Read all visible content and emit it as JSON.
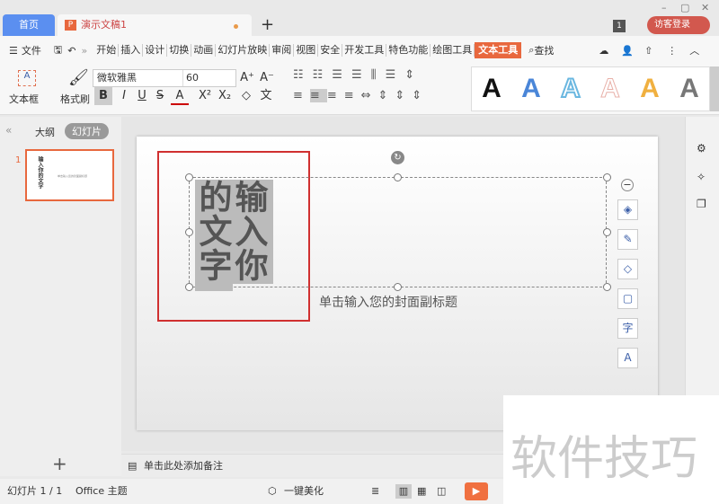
{
  "tabs": {
    "home": "首页",
    "doc": "演示文稿1",
    "new": "+"
  },
  "titlebar": {
    "badge": "1",
    "login": "访客登录",
    "minimize": "–",
    "maximize": "▢",
    "close": "✕"
  },
  "menu": {
    "file": "文件",
    "items": [
      "开始",
      "插入",
      "设计",
      "切换",
      "动画",
      "幻灯片放映",
      "审阅",
      "视图",
      "安全",
      "开发工具",
      "特色功能",
      "绘图工具",
      "文本工具"
    ],
    "active": "文本工具",
    "search": "查找"
  },
  "ribbon": {
    "textbox": "文本框",
    "format_painter": "格式刷",
    "font": "微软雅黑",
    "size": "60",
    "styles": [
      {
        "color": "#111111"
      },
      {
        "color": "#4a86d8"
      },
      {
        "color": "#6ab7e0"
      },
      {
        "color": "#e8b0a8"
      },
      {
        "color": "#f0b040"
      },
      {
        "color": "#777777"
      }
    ],
    "style_letter": "A",
    "bold": "B",
    "italic": "I",
    "underline": "U",
    "strike": "S",
    "fontcolor": "A",
    "pinyin": "文"
  },
  "left_panel": {
    "outline": "大纲",
    "slides": "幻灯片",
    "slide_number": "1",
    "add": "+"
  },
  "slide": {
    "vertical_text": "输入你的文字",
    "subtitle": "单击输入您的封面副标题"
  },
  "notes": {
    "placeholder": "单击此处添加备注"
  },
  "status": {
    "slide_count": "幻灯片 1 / 1",
    "theme": "Office 主题",
    "beautify": "一键美化"
  },
  "watermark": "软件技巧"
}
